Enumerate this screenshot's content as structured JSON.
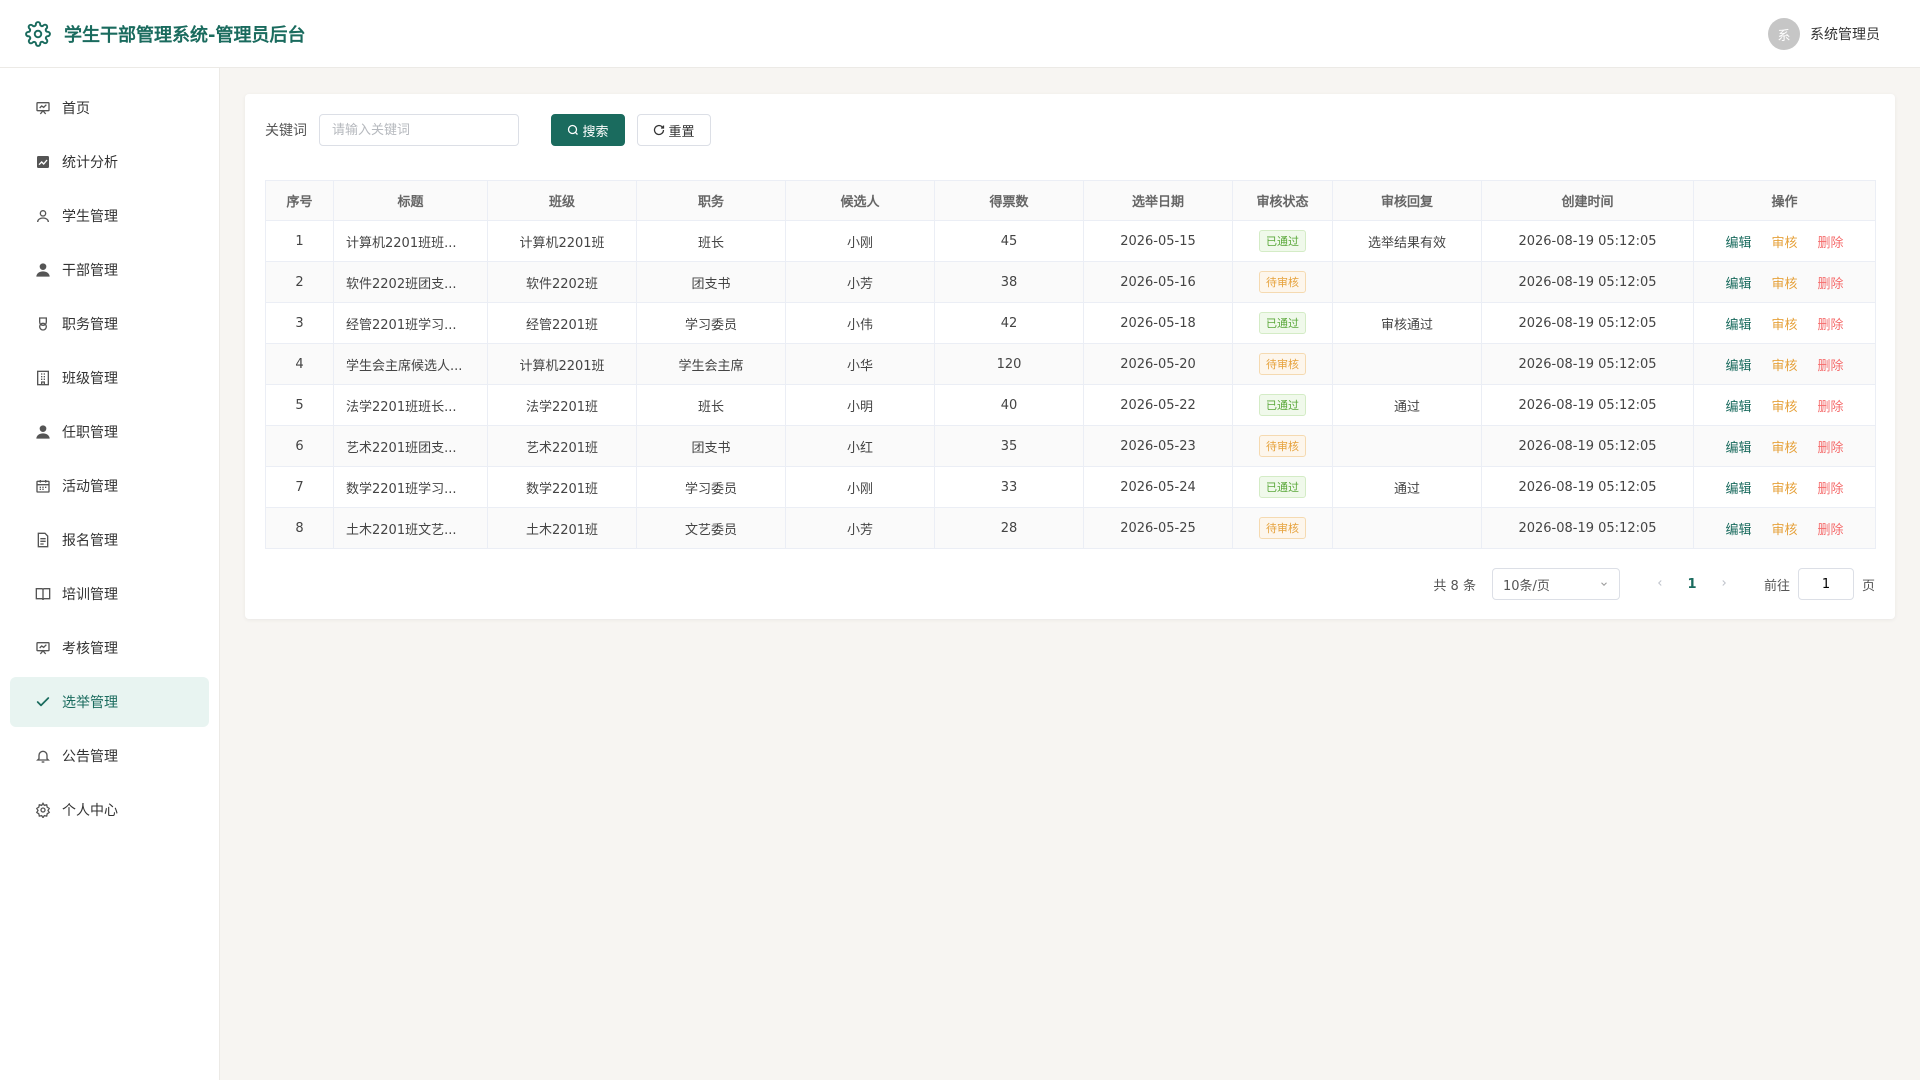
{
  "header": {
    "title": "学生干部管理系统-管理员后台",
    "avatar_text": "系",
    "username": "系统管理员"
  },
  "sidebar": {
    "items": [
      {
        "label": "首页",
        "icon": "presentation-icon"
      },
      {
        "label": "统计分析",
        "icon": "chart-icon"
      },
      {
        "label": "学生管理",
        "icon": "user-outline-icon"
      },
      {
        "label": "干部管理",
        "icon": "user-filled-icon"
      },
      {
        "label": "职务管理",
        "icon": "badge-icon"
      },
      {
        "label": "班级管理",
        "icon": "building-icon"
      },
      {
        "label": "任职管理",
        "icon": "user-filled-icon"
      },
      {
        "label": "活动管理",
        "icon": "calendar-icon"
      },
      {
        "label": "报名管理",
        "icon": "document-icon"
      },
      {
        "label": "培训管理",
        "icon": "book-icon"
      },
      {
        "label": "考核管理",
        "icon": "presentation-icon"
      },
      {
        "label": "选举管理",
        "icon": "check-icon",
        "active": true
      },
      {
        "label": "公告管理",
        "icon": "bell-icon"
      },
      {
        "label": "个人中心",
        "icon": "gear-icon"
      }
    ]
  },
  "search": {
    "label": "关键词",
    "placeholder": "请输入关键词",
    "value": "",
    "search_label": "搜索",
    "reset_label": "重置"
  },
  "table": {
    "columns": [
      "序号",
      "标题",
      "班级",
      "职务",
      "候选人",
      "得票数",
      "选举日期",
      "审核状态",
      "审核回复",
      "创建时间",
      "操作"
    ],
    "actions": {
      "edit": "编辑",
      "audit": "审核",
      "delete": "删除"
    },
    "rows": [
      {
        "no": "1",
        "title": "计算机2201班班...",
        "class": "计算机2201班",
        "position": "班长",
        "candidate": "小刚",
        "votes": "45",
        "date": "2026-05-15",
        "status": "已通过",
        "status_type": "approved",
        "reply": "选举结果有效",
        "created": "2026-08-19 05:12:05"
      },
      {
        "no": "2",
        "title": "软件2202班团支...",
        "class": "软件2202班",
        "position": "团支书",
        "candidate": "小芳",
        "votes": "38",
        "date": "2026-05-16",
        "status": "待审核",
        "status_type": "pending",
        "reply": "",
        "created": "2026-08-19 05:12:05"
      },
      {
        "no": "3",
        "title": "经管2201班学习...",
        "class": "经管2201班",
        "position": "学习委员",
        "candidate": "小伟",
        "votes": "42",
        "date": "2026-05-18",
        "status": "已通过",
        "status_type": "approved",
        "reply": "审核通过",
        "created": "2026-08-19 05:12:05"
      },
      {
        "no": "4",
        "title": "学生会主席候选人...",
        "class": "计算机2201班",
        "position": "学生会主席",
        "candidate": "小华",
        "votes": "120",
        "date": "2026-05-20",
        "status": "待审核",
        "status_type": "pending",
        "reply": "",
        "created": "2026-08-19 05:12:05"
      },
      {
        "no": "5",
        "title": "法学2201班班长...",
        "class": "法学2201班",
        "position": "班长",
        "candidate": "小明",
        "votes": "40",
        "date": "2026-05-22",
        "status": "已通过",
        "status_type": "approved",
        "reply": "通过",
        "created": "2026-08-19 05:12:05"
      },
      {
        "no": "6",
        "title": "艺术2201班团支...",
        "class": "艺术2201班",
        "position": "团支书",
        "candidate": "小红",
        "votes": "35",
        "date": "2026-05-23",
        "status": "待审核",
        "status_type": "pending",
        "reply": "",
        "created": "2026-08-19 05:12:05"
      },
      {
        "no": "7",
        "title": "数学2201班学习...",
        "class": "数学2201班",
        "position": "学习委员",
        "candidate": "小刚",
        "votes": "33",
        "date": "2026-05-24",
        "status": "已通过",
        "status_type": "approved",
        "reply": "通过",
        "created": "2026-08-19 05:12:05"
      },
      {
        "no": "8",
        "title": "土木2201班文艺...",
        "class": "土木2201班",
        "position": "文艺委员",
        "candidate": "小芳",
        "votes": "28",
        "date": "2026-05-25",
        "status": "待审核",
        "status_type": "pending",
        "reply": "",
        "created": "2026-08-19 05:12:05"
      }
    ]
  },
  "pagination": {
    "total": "共 8 条",
    "page_size": "10条/页",
    "current_page": "1",
    "goto_label": "前往",
    "goto_value": "1",
    "page_suffix": "页"
  },
  "colors": {
    "primary": "#1a6b5e",
    "approved": "#5aa83a",
    "pending": "#e6a23c",
    "danger": "#f56c6c"
  }
}
